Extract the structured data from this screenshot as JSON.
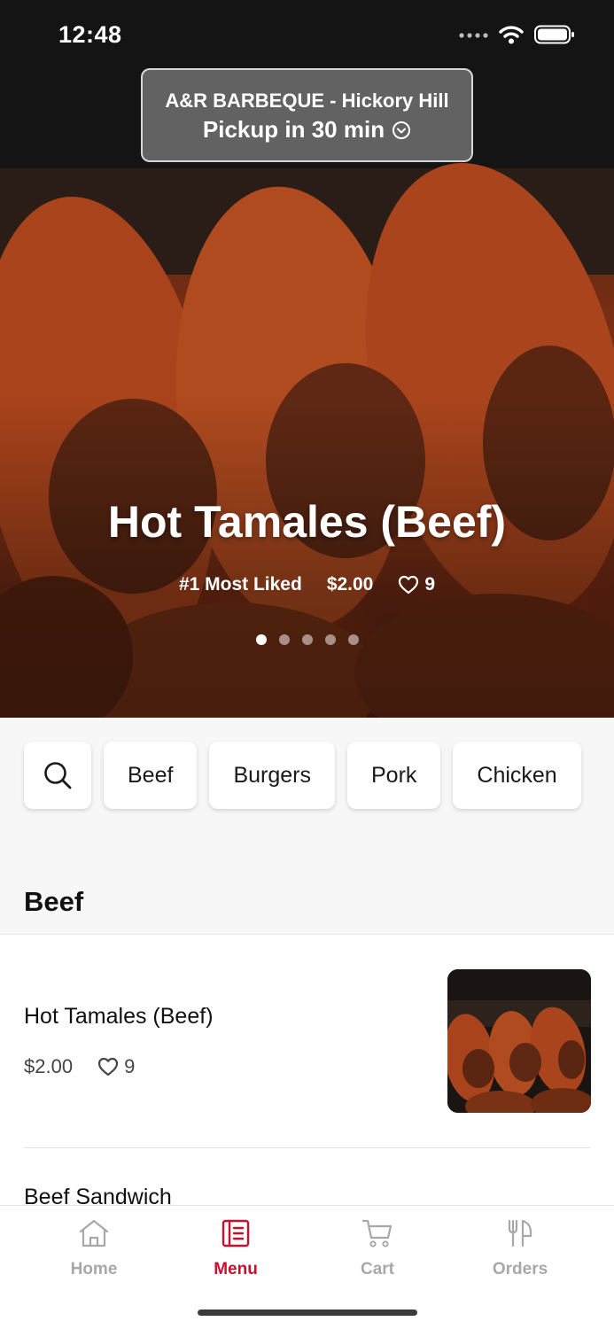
{
  "status_bar": {
    "time": "12:48"
  },
  "store": {
    "name": "A&R BARBEQUE - Hickory Hill",
    "pickup": "Pickup in 30 min"
  },
  "hero": {
    "title": "Hot Tamales (Beef)",
    "badge": "#1 Most Liked",
    "price": "$2.00",
    "likes": "9",
    "slides": 5,
    "active_slide": 1
  },
  "categories": [
    "Beef",
    "Burgers",
    "Pork",
    "Chicken"
  ],
  "section": {
    "title": "Beef"
  },
  "items": [
    {
      "name": "Hot Tamales (Beef)",
      "price": "$2.00",
      "likes": "9"
    },
    {
      "name": "Beef Sandwich"
    }
  ],
  "tabs": [
    {
      "label": "Home",
      "icon": "home-icon"
    },
    {
      "label": "Menu",
      "icon": "menu-icon",
      "active": true
    },
    {
      "label": "Cart",
      "icon": "cart-icon"
    },
    {
      "label": "Orders",
      "icon": "orders-icon"
    }
  ],
  "colors": {
    "accent": "#c8102e",
    "inactive": "#a8a8a8"
  }
}
